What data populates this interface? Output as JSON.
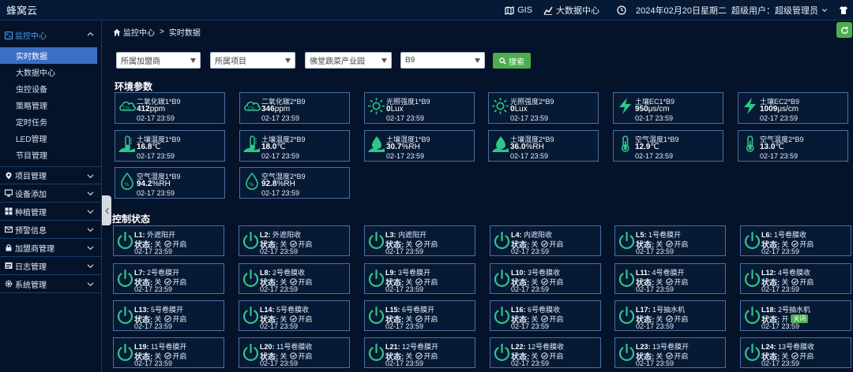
{
  "app": {
    "brand": "蜂窝云"
  },
  "topnav": {
    "gis": "GIS",
    "bigdata": "大数据中心",
    "datetime": "2024年02月20日星期二",
    "user_label": "超级用户：",
    "user_name": "超级管理员"
  },
  "sidebar": {
    "monitor": "监控中心",
    "subs": [
      "实时数据",
      "大数据中心",
      "虫控设备",
      "策略管理",
      "定时任务",
      "LED管理",
      "节目管理"
    ],
    "groups": [
      "项目管理",
      "设备添加",
      "种植管理",
      "预警信息",
      "加盟商管理",
      "日志管理",
      "系统管理"
    ]
  },
  "breadcrumb": {
    "root": "监控中心",
    "sep": ">",
    "current": "实时数据"
  },
  "filters": {
    "franchisee": "所属加盟商",
    "project": "所属项目",
    "park": "佛堂蔬菜产业园",
    "zone": "B9",
    "search": "搜索"
  },
  "sections": {
    "env": "环境参数",
    "ctrl": "控制状态"
  },
  "env_params": [
    {
      "name": "二氧化碳1*B9",
      "value": "412",
      "unit": "ppm",
      "time": "02-17 23:59",
      "icon": "co2-icon"
    },
    {
      "name": "二氧化碳2*B9",
      "value": "346",
      "unit": "ppm",
      "time": "02-17 23:59",
      "icon": "co2-icon"
    },
    {
      "name": "光照强度1*B9",
      "value": "0",
      "unit": "Lux",
      "time": "02-17 23:59",
      "icon": "sun-icon"
    },
    {
      "name": "光照强度2*B9",
      "value": "0",
      "unit": "Lux",
      "time": "02-17 23:59",
      "icon": "sun-icon"
    },
    {
      "name": "土壤EC1*B9",
      "value": "950",
      "unit": "μs/cm",
      "time": "02-17 23:59",
      "icon": "lightning-icon"
    },
    {
      "name": "土壤EC2*B9",
      "value": "1009",
      "unit": "μs/cm",
      "time": "02-17 23:59",
      "icon": "lightning-icon"
    },
    {
      "name": "土壤温度1*B9",
      "value": "16.8",
      "unit": "℃",
      "time": "02-17 23:59",
      "icon": "soil-thermometer-icon"
    },
    {
      "name": "土壤温度2*B9",
      "value": "18.0",
      "unit": "℃",
      "time": "02-17 23:59",
      "icon": "soil-thermometer-icon"
    },
    {
      "name": "土壤湿度1*B9",
      "value": "30.7",
      "unit": "%RH",
      "time": "02-17 23:59",
      "icon": "soil-drop-icon"
    },
    {
      "name": "土壤湿度2*B9",
      "value": "36.0",
      "unit": "%RH",
      "time": "02-17 23:59",
      "icon": "soil-drop-icon"
    },
    {
      "name": "空气温度1*B9",
      "value": "12.9",
      "unit": "℃",
      "time": "02-17 23:59",
      "icon": "thermometer-icon"
    },
    {
      "name": "空气温度2*B9",
      "value": "13.0",
      "unit": "℃",
      "time": "02-17 23:59",
      "icon": "thermometer-icon"
    },
    {
      "name": "空气湿度1*B9",
      "value": "94.2",
      "unit": "%RH",
      "time": "02-17 23:59",
      "icon": "humidity-drop-icon"
    },
    {
      "name": "空气湿度2*B9",
      "value": "92.8",
      "unit": "%RH",
      "time": "02-17 23:59",
      "icon": "humidity-drop-icon"
    }
  ],
  "controls": [
    {
      "id": "L1:",
      "name": "外遮阳开",
      "state_label": "状态:",
      "state": "关",
      "action": "开启",
      "time": "02-17 23:59"
    },
    {
      "id": "L2:",
      "name": "外遮阳收",
      "state_label": "状态:",
      "state": "关",
      "action": "开启",
      "time": "02-17 23:59"
    },
    {
      "id": "L3:",
      "name": "内遮阳开",
      "state_label": "状态:",
      "state": "关",
      "action": "开启",
      "time": "02-17 23:59"
    },
    {
      "id": "L4:",
      "name": "内遮阳收",
      "state_label": "状态:",
      "state": "关",
      "action": "开启",
      "time": "02-17 23:59"
    },
    {
      "id": "L5:",
      "name": "1号卷膜开",
      "state_label": "状态:",
      "state": "关",
      "action": "开启",
      "time": "02-17 23:59"
    },
    {
      "id": "L6:",
      "name": "1号卷膜收",
      "state_label": "状态:",
      "state": "关",
      "action": "开启",
      "time": "02-17 23:59"
    },
    {
      "id": "L7:",
      "name": "2号卷膜开",
      "state_label": "状态:",
      "state": "关",
      "action": "开启",
      "time": "02-17 23:59"
    },
    {
      "id": "L8:",
      "name": "2号卷膜收",
      "state_label": "状态:",
      "state": "关",
      "action": "开启",
      "time": "02-17 23:59"
    },
    {
      "id": "L9:",
      "name": "3号卷膜开",
      "state_label": "状态:",
      "state": "关",
      "action": "开启",
      "time": "02-17 23:59"
    },
    {
      "id": "L10:",
      "name": "3号卷膜收",
      "state_label": "状态:",
      "state": "关",
      "action": "开启",
      "time": "02-17 23:59"
    },
    {
      "id": "L11:",
      "name": "4号卷膜开",
      "state_label": "状态:",
      "state": "关",
      "action": "开启",
      "time": "02-17 23:59"
    },
    {
      "id": "L12:",
      "name": "4号卷膜收",
      "state_label": "状态:",
      "state": "关",
      "action": "开启",
      "time": "02-17 23:59"
    },
    {
      "id": "L13:",
      "name": "5号卷膜开",
      "state_label": "状态:",
      "state": "关",
      "action": "开启",
      "time": "02-17 23:59"
    },
    {
      "id": "L14:",
      "name": "5号卷膜收",
      "state_label": "状态:",
      "state": "关",
      "action": "开启",
      "time": "02-17 23:59"
    },
    {
      "id": "L15:",
      "name": "6号卷膜开",
      "state_label": "状态:",
      "state": "关",
      "action": "开启",
      "time": "02-17 23:59"
    },
    {
      "id": "L16:",
      "name": "6号卷膜收",
      "state_label": "状态:",
      "state": "关",
      "action": "开启",
      "time": "02-17 23:59"
    },
    {
      "id": "L17:",
      "name": "1号抽水机",
      "state_label": "状态:",
      "state": "关",
      "action": "开启",
      "time": "02-17 23:59"
    },
    {
      "id": "L18:",
      "name": "2号抽水机",
      "state_label": "状态:",
      "state": "开",
      "action": "关闭",
      "time": "02-17 23:59"
    },
    {
      "id": "L19:",
      "name": "11号卷膜开",
      "state_label": "状态:",
      "state": "关",
      "action": "开启",
      "time": "02-17 23:59"
    },
    {
      "id": "L20:",
      "name": "11号卷膜收",
      "state_label": "状态:",
      "state": "关",
      "action": "开启",
      "time": "02-17 23:59"
    },
    {
      "id": "L21:",
      "name": "12号卷膜开",
      "state_label": "状态:",
      "state": "关",
      "action": "开启",
      "time": "02-17 23:59"
    },
    {
      "id": "L22:",
      "name": "12号卷膜收",
      "state_label": "状态:",
      "state": "关",
      "action": "开启",
      "time": "02-17 23:59"
    },
    {
      "id": "L23:",
      "name": "13号卷膜开",
      "state_label": "状态:",
      "state": "关",
      "action": "开启",
      "time": "02-17 23:59"
    },
    {
      "id": "L24:",
      "name": "13号卷膜收",
      "state_label": "状态:",
      "state": "关",
      "action": "开启",
      "time": "02-17 23:59"
    }
  ],
  "colors": {
    "accent": "#3ea0ff",
    "icon_green": "#2fc68a",
    "button_green": "#4cae4c",
    "bg": "#05132a",
    "card_border": "#4a6fa2"
  }
}
